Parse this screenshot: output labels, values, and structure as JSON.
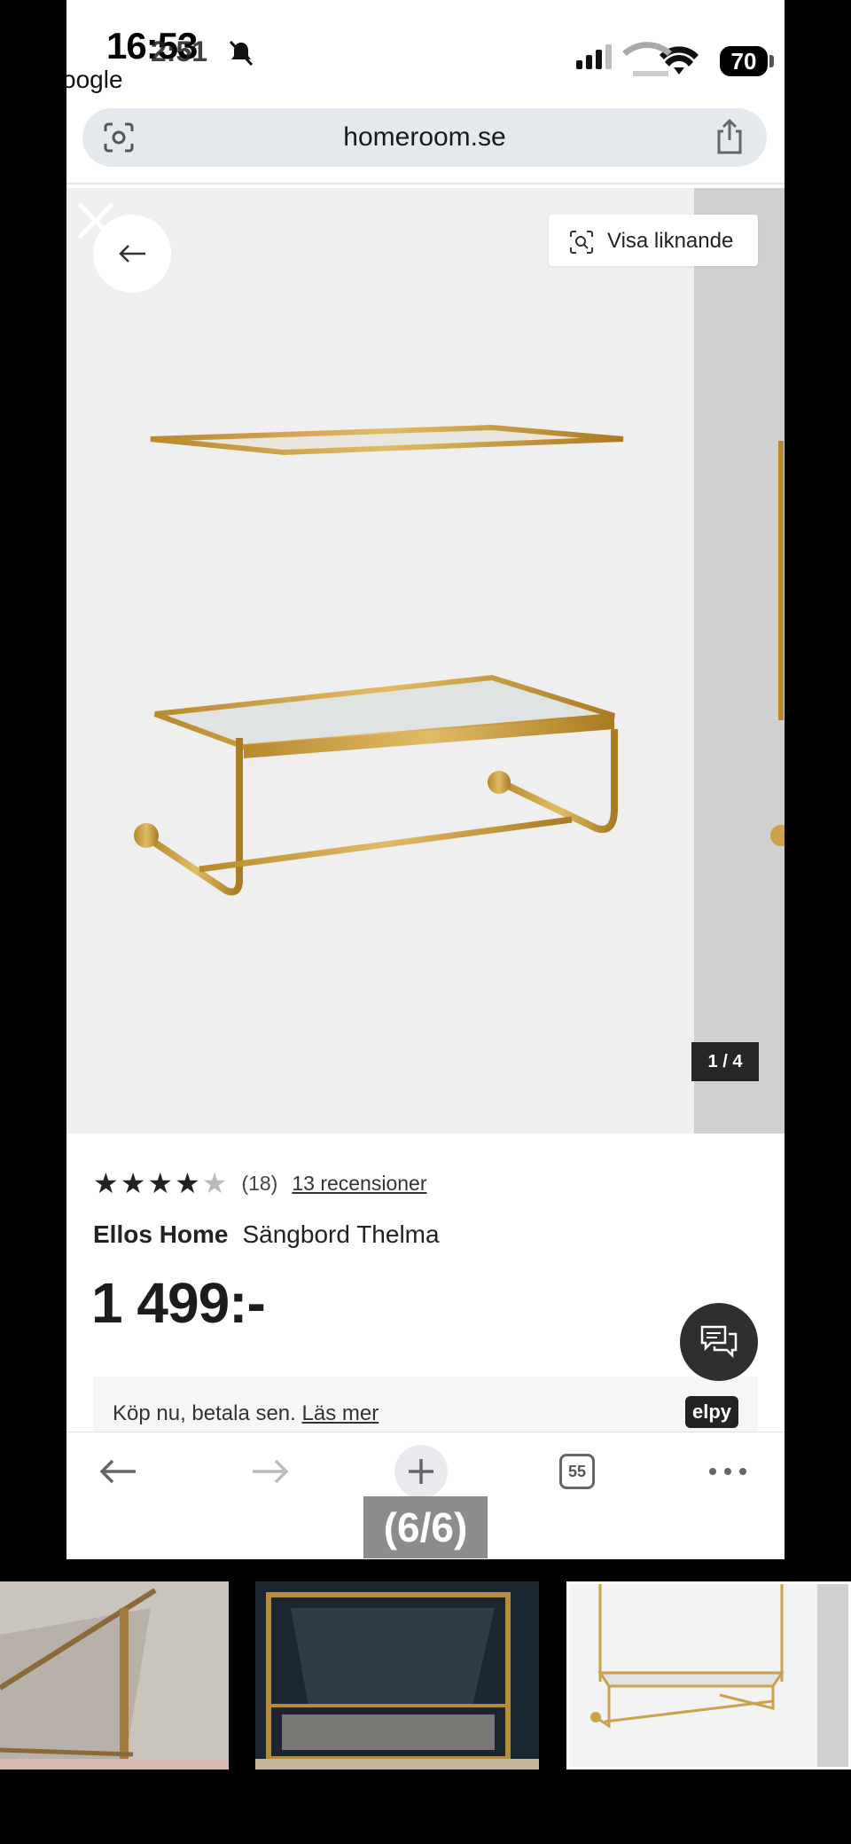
{
  "status_bar": {
    "time": "16:53",
    "time_overlay": "2:51",
    "back_app": "oogle",
    "battery": "70"
  },
  "address_bar": {
    "url": "homeroom.se"
  },
  "gallery": {
    "similar_label": "Visa liknande",
    "counter": "1 / 4"
  },
  "product": {
    "rating": 4,
    "rating_max": 5,
    "review_count": "(18)",
    "reviews_link": "13 recensioner",
    "brand": "Ellos Home",
    "name": "Sängbord Thelma",
    "price": "1 499:-"
  },
  "payment": {
    "text": "Köp nu, betala sen.",
    "link": "Läs mer",
    "provider": "elpy"
  },
  "toolbar": {
    "tab_count": "55"
  },
  "overlay": {
    "page_count": "(6/6)"
  },
  "colors": {
    "gold": "#c9a24a",
    "dark_button": "#2f2f2f"
  }
}
